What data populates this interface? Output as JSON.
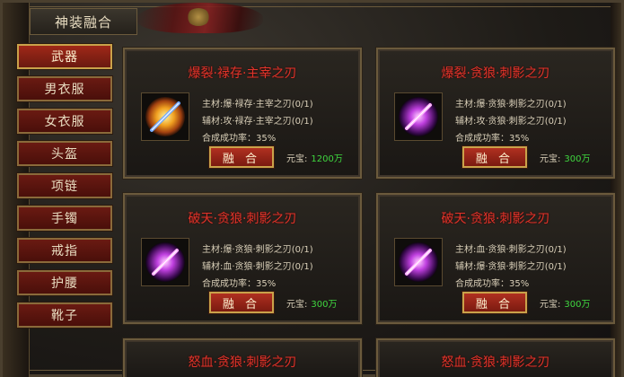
{
  "window": {
    "title": "神装融合"
  },
  "sidebar": {
    "items": [
      {
        "label": "武器",
        "active": true
      },
      {
        "label": "男衣服",
        "active": false
      },
      {
        "label": "女衣服",
        "active": false
      },
      {
        "label": "头盔",
        "active": false
      },
      {
        "label": "项链",
        "active": false
      },
      {
        "label": "手镯",
        "active": false
      },
      {
        "label": "戒指",
        "active": false
      },
      {
        "label": "护腰",
        "active": false
      },
      {
        "label": "靴子",
        "active": false
      }
    ]
  },
  "cards": [
    {
      "title": "爆裂·禄存·主宰之刃",
      "icon": "golden-sword-icon",
      "main_material": "主材:爆·禄存·主宰之刃(0/1)",
      "aux_material": "辅材:攻·禄存·主宰之刃(0/1)",
      "success_rate": "合成成功率：35%",
      "fuse_label": "融 合",
      "price_label": "元宝:",
      "price_value": "1200万"
    },
    {
      "title": "爆裂·贪狼·刺影之刃",
      "icon": "purple-sword-icon",
      "main_material": "主材:爆·贪狼·刺影之刃(0/1)",
      "aux_material": "辅材:攻·贪狼·刺影之刃(0/1)",
      "success_rate": "合成成功率：35%",
      "fuse_label": "融 合",
      "price_label": "元宝:",
      "price_value": "300万"
    },
    {
      "title": "破天·贪狼·刺影之刃",
      "icon": "purple-sword-icon",
      "main_material": "主材:爆·贪狼·刺影之刃(0/1)",
      "aux_material": "辅材:血·贪狼·刺影之刃(0/1)",
      "success_rate": "合成成功率：35%",
      "fuse_label": "融 合",
      "price_label": "元宝:",
      "price_value": "300万"
    },
    {
      "title": "破天·贪狼·刺影之刃",
      "icon": "purple-sword-icon",
      "main_material": "主材:血·贪狼·刺影之刃(0/1)",
      "aux_material": "辅材:爆·贪狼·刺影之刃(0/1)",
      "success_rate": "合成成功率：35%",
      "fuse_label": "融 合",
      "price_label": "元宝:",
      "price_value": "300万"
    },
    {
      "title": "怒血·贪狼·刺影之刃"
    },
    {
      "title": "怒血·贪狼·刺影之刃"
    }
  ],
  "colors": {
    "title_red": "#e0342a",
    "price_green": "#3fd63f",
    "gold_border": "#c9a24a"
  }
}
